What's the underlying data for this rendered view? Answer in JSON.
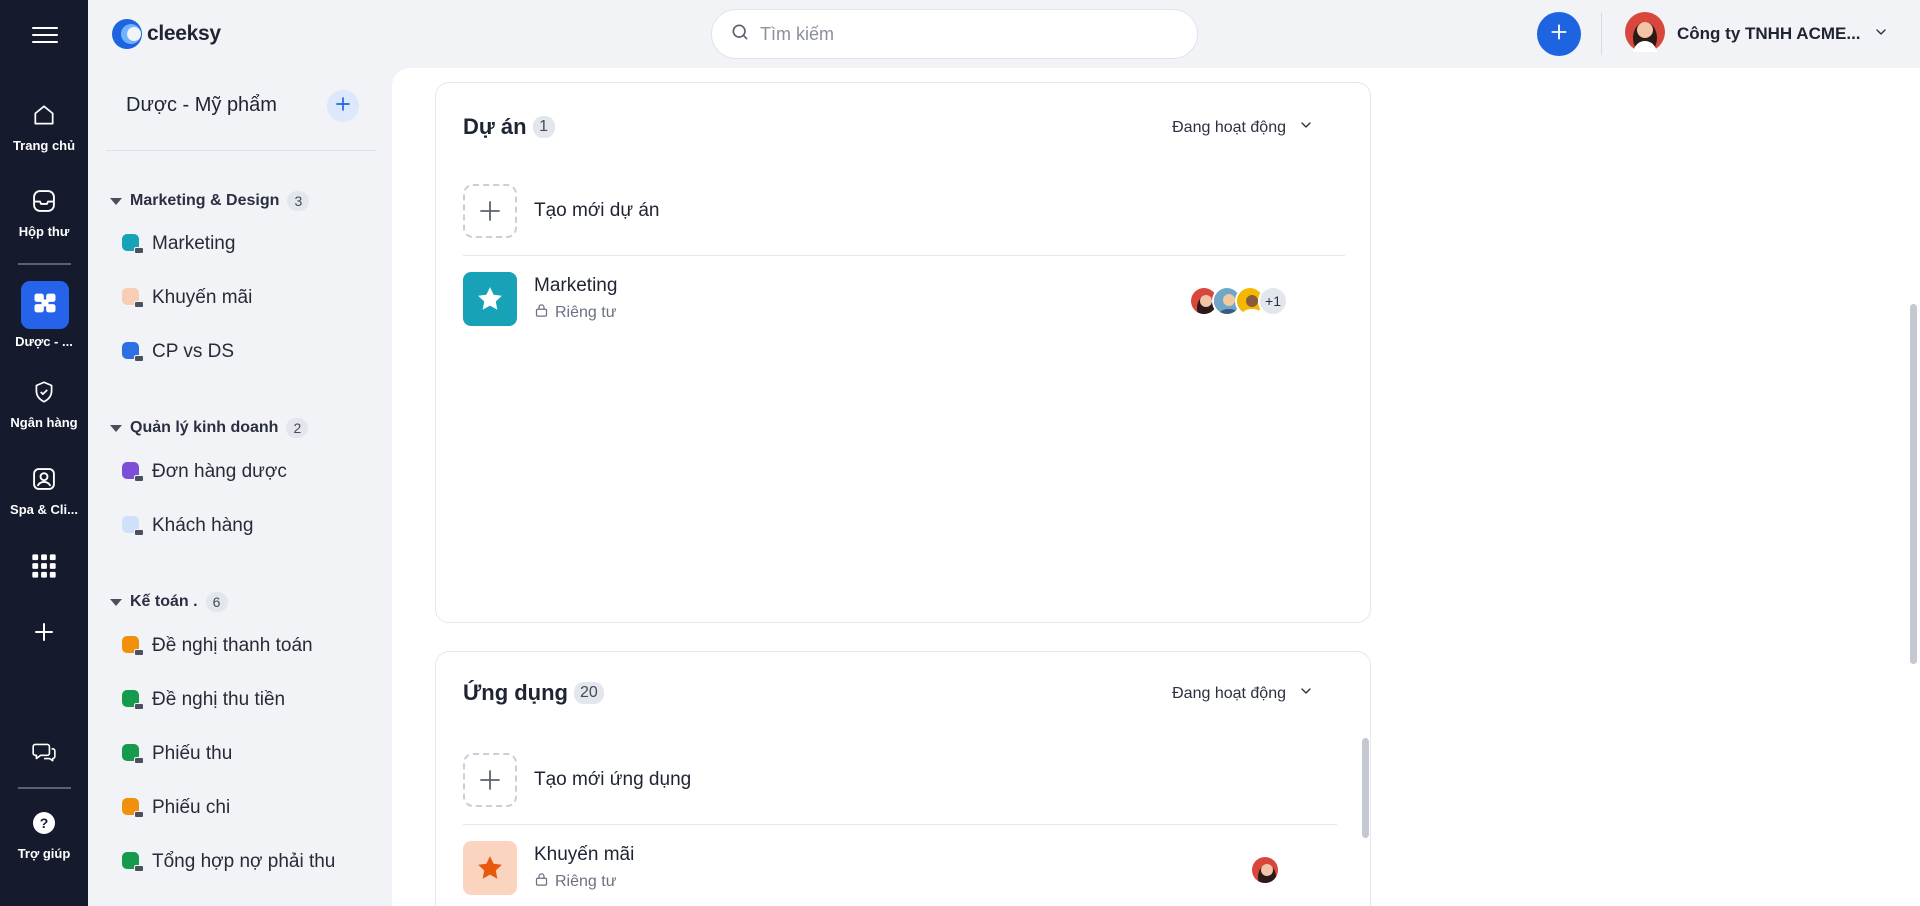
{
  "rail": {
    "items": [
      {
        "label": "Trang chủ",
        "icon": "home-icon"
      },
      {
        "label": "Hộp thư",
        "icon": "inbox-icon"
      },
      {
        "label": "Dược - ...",
        "icon": "workspace-icon"
      },
      {
        "label": "Ngân hàng",
        "icon": "shield-check-icon"
      },
      {
        "label": "Spa & Cli...",
        "icon": "user-badge-icon"
      },
      {
        "label": "",
        "icon": "apps-grid-icon"
      },
      {
        "label": "",
        "icon": "plus-icon"
      },
      {
        "label": "",
        "icon": "chat-icon"
      },
      {
        "label": "Trợ giúp",
        "icon": "help-icon"
      }
    ]
  },
  "header": {
    "brand": "cleeksy",
    "search_placeholder": "Tìm kiếm",
    "company_name": "Công ty TNHH ACME..."
  },
  "sidebar": {
    "title": "Dược - Mỹ phẩm",
    "groups": [
      {
        "name": "Marketing & Design",
        "count": "3",
        "items": [
          {
            "label": "Marketing",
            "color": "#17a2b8"
          },
          {
            "label": "Khuyến mãi",
            "color": "#f9cdb4"
          },
          {
            "label": "CP vs DS",
            "color": "#2f6fe4"
          }
        ]
      },
      {
        "name": "Quản lý kinh doanh",
        "count": "2",
        "items": [
          {
            "label": "Đơn hàng dược",
            "color": "#7c4fd6"
          },
          {
            "label": "Khách hàng",
            "color": "#cfe0fb"
          }
        ]
      },
      {
        "name": "Kế toán .",
        "count": "6",
        "items": [
          {
            "label": "Đề nghị thanh toán",
            "color": "#f0900c"
          },
          {
            "label": "Đề nghị thu tiền",
            "color": "#159a4e"
          },
          {
            "label": "Phiếu thu",
            "color": "#159a4e"
          },
          {
            "label": "Phiếu chi",
            "color": "#f0900c"
          },
          {
            "label": "Tổng hợp nợ phải thu",
            "color": "#159a4e"
          }
        ]
      }
    ]
  },
  "projects": {
    "title": "Dự án",
    "count": "1",
    "status": "Đang hoạt động",
    "create_label": "Tạo mới dự án",
    "items": [
      {
        "name": "Marketing",
        "privacy": "Riêng tư",
        "color": "#17a2b8",
        "extra_members": "+1"
      }
    ]
  },
  "apps": {
    "title": "Ứng dụng",
    "count": "20",
    "status": "Đang hoạt động",
    "create_label": "Tạo mới ứng dụng",
    "items": [
      {
        "name": "Khuyến mãi",
        "privacy": "Riêng tư",
        "color": "#fbd4c0"
      }
    ]
  }
}
